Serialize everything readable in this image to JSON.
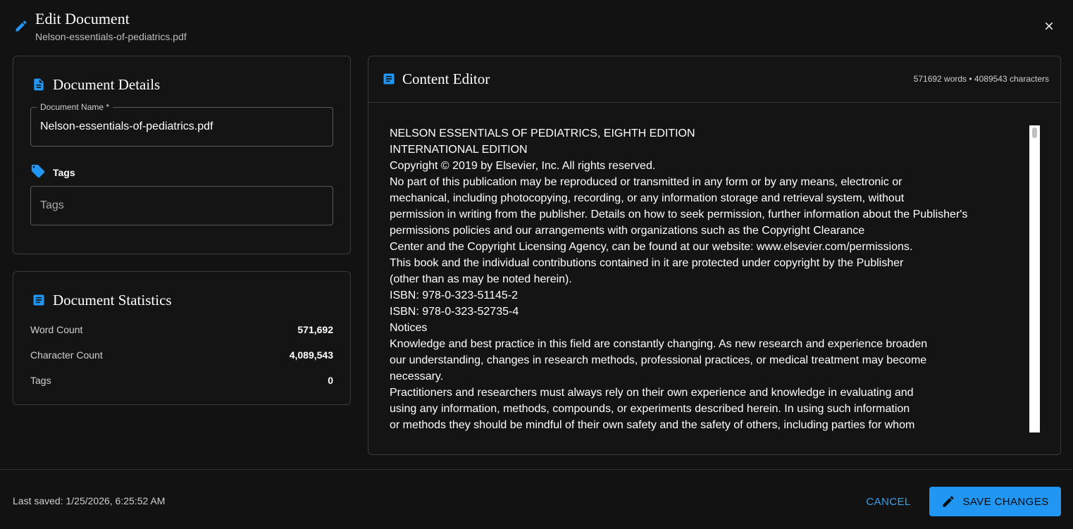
{
  "header": {
    "title": "Edit Document",
    "subtitle": "Nelson-essentials-of-pediatrics.pdf"
  },
  "details": {
    "title": "Document Details",
    "name_label": "Document Name *",
    "name_value": "Nelson-essentials-of-pediatrics.pdf",
    "tags_label": "Tags",
    "tags_placeholder": "Tags"
  },
  "stats": {
    "title": "Document Statistics",
    "rows": [
      {
        "label": "Word Count",
        "value": "571,692"
      },
      {
        "label": "Character Count",
        "value": "4,089,543"
      },
      {
        "label": "Tags",
        "value": "0"
      }
    ]
  },
  "editor": {
    "title": "Content Editor",
    "counts": "571692 words • 4089543 characters",
    "content": "NELSON ESSENTIALS OF PEDIATRICS, EIGHTH EDITION\nINTERNATIONAL EDITION\nCopyright © 2019 by Elsevier, Inc. All rights reserved.\nNo part of this publication may be reproduced or transmitted in any form or by any means, electronic or\nmechanical, including photocopying, recording, or any information storage and retrieval system, without\npermission in writing from the publisher. Details on how to seek permission, further information about the Publisher's\npermissions policies and our arrangements with organizations such as the Copyright Clearance\nCenter and the Copyright Licensing Agency, can be found at our website: www.elsevier.com/permissions.\nThis book and the individual contributions contained in it are protected under copyright by the Publisher\n(other than as may be noted herein).\nISBN: 978-0-323-51145-2\nISBN: 978-0-323-52735-4\nNotices\nKnowledge and best practice in this field are constantly changing. As new research and experience broaden\nour understanding, changes in research methods, professional practices, or medical treatment may become\nnecessary.\nPractitioners and researchers must always rely on their own experience and knowledge in evaluating and\nusing any information, methods, compounds, or experiments described herein. In using such information\nor methods they should be mindful of their own safety and the safety of others, including parties for whom"
  },
  "footer": {
    "last_saved": "Last saved: 1/25/2026, 6:25:52 AM",
    "cancel_label": "CANCEL",
    "save_label": "SAVE CHANGES"
  },
  "colors": {
    "accent": "#2196f3",
    "background": "#121212"
  }
}
